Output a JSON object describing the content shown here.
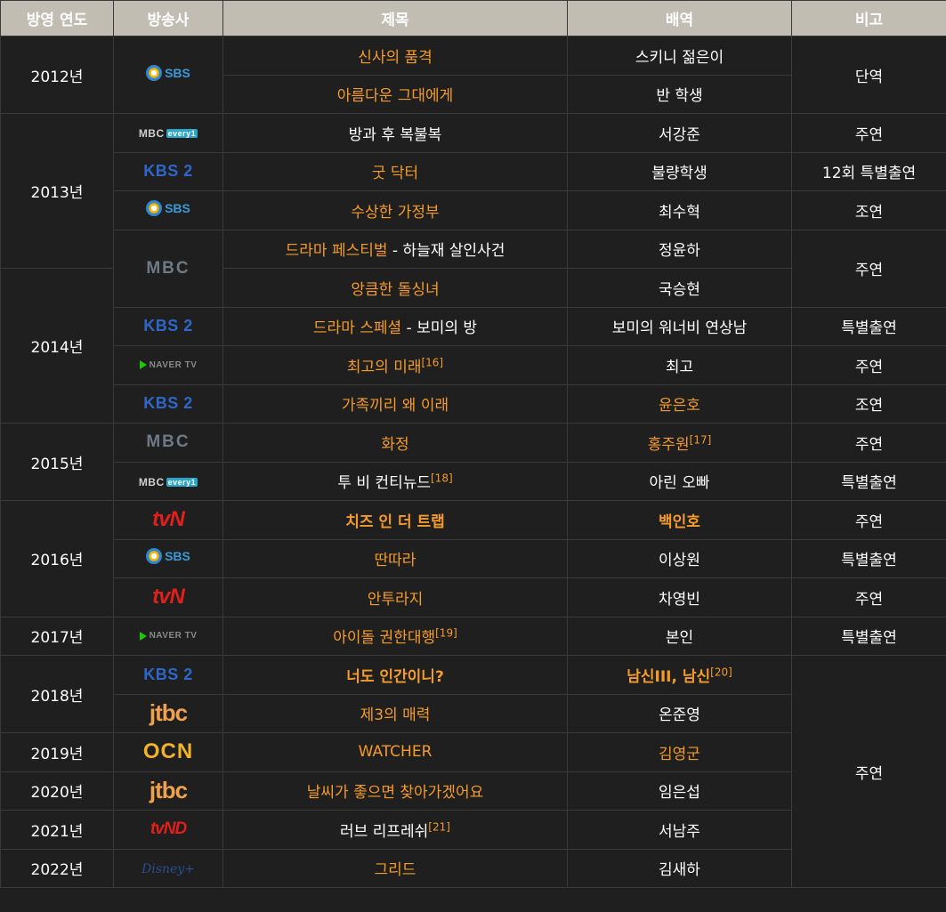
{
  "headers": [
    "방영 연도",
    "방송사",
    "제목",
    "배역",
    "비고"
  ],
  "years": {
    "y2012": "2012년",
    "y2013": "2013년",
    "y2014": "2014년",
    "y2015": "2015년",
    "y2016": "2016년",
    "y2017": "2017년",
    "y2018": "2018년",
    "y2019": "2019년",
    "y2020": "2020년",
    "y2021": "2021년",
    "y2022": "2022년"
  },
  "logos": {
    "sbs": "SBS",
    "mbc_every1": "MBC",
    "mbc_every1_tag": "every1",
    "kbs2": "KBS 2",
    "mbc": "MBC",
    "naver": "NAVER TV",
    "tvn": "tvN",
    "jtbc": "jtbc",
    "ocn": "OCN",
    "tvnd": "tvND",
    "disney": "Disney+"
  },
  "rows": [
    {
      "title": "신사의 품격",
      "role": "스키니 젊은이"
    },
    {
      "title": "아름다운 그대에게",
      "role": "반 학생"
    },
    {
      "title": "방과 후 복불복",
      "role": "서강준",
      "note": "주연"
    },
    {
      "title": "굿 닥터",
      "role": "불량학생",
      "note": "12회 특별출연"
    },
    {
      "title": "수상한 가정부",
      "role": "최수혁",
      "note": "조연"
    },
    {
      "title_link": "드라마 페스티벌",
      "title_rest": " - 하늘재 살인사건",
      "role": "정윤하"
    },
    {
      "title": "앙큼한 돌싱녀",
      "role": "국승현"
    },
    {
      "title_link": "드라마 스페셜",
      "title_rest": " - 보미의 방",
      "role": "보미의 워너비 연상남",
      "note": "특별출연"
    },
    {
      "title": "최고의 미래",
      "title_sup": "[16]",
      "role": "최고",
      "note": "주연"
    },
    {
      "title": "가족끼리 왜 이래",
      "role": "윤은호",
      "note": "조연"
    },
    {
      "title": "화정",
      "role": "홍주원",
      "role_sup": "[17]",
      "note": "주연"
    },
    {
      "title": "투 비 컨티뉴드",
      "title_sup": "[18]",
      "role": "아린 오빠",
      "note": "특별출연"
    },
    {
      "title": "치즈 인 더 트랩",
      "role": "백인호",
      "note": "주연"
    },
    {
      "title": "딴따라",
      "role": "이상원",
      "note": "특별출연"
    },
    {
      "title": "안투라지",
      "role": "차영빈",
      "note": "주연"
    },
    {
      "title": "아이돌 권한대행",
      "title_sup": "[19]",
      "role": "본인",
      "note": "특별출연"
    },
    {
      "title": "너도 인간이니?",
      "role": "남신III, 남신",
      "role_sup": "[20]"
    },
    {
      "title": "제3의 매력",
      "role": "온준영"
    },
    {
      "title": "WATCHER",
      "role": "김영군"
    },
    {
      "title": "날씨가 좋으면 찾아가겠어요",
      "role": "임은섭"
    },
    {
      "title": "러브 리프레쉬",
      "title_sup": "[21]",
      "role": "서남주"
    },
    {
      "title": "그리드",
      "role": "김새하"
    }
  ],
  "merged_notes": {
    "r0_1": "단역",
    "r5_6": "주연",
    "r16_21": "주연"
  },
  "colors": {
    "header_bg": "#c2bdb2",
    "body_bg": "#1f1f1f",
    "link": "#f59b2b"
  }
}
